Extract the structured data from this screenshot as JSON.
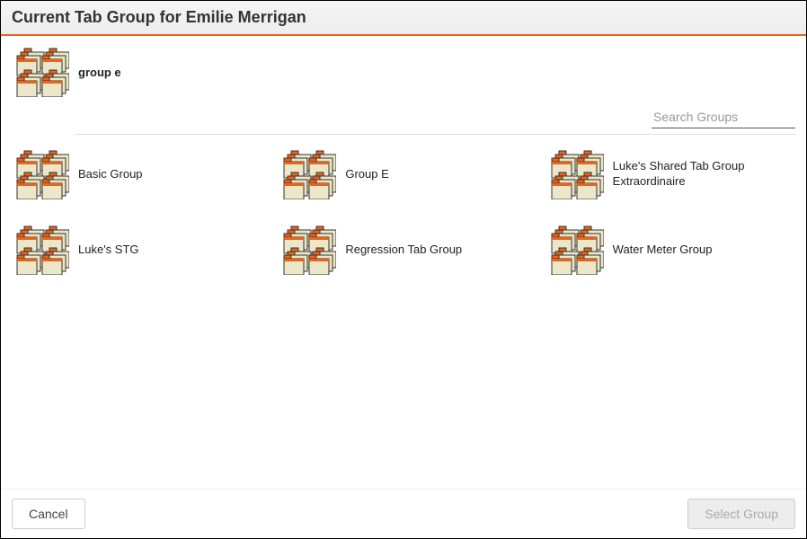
{
  "header": {
    "title": "Current Tab Group for Emilie Merrigan"
  },
  "current_group": {
    "label": "group e"
  },
  "search": {
    "placeholder": "Search Groups"
  },
  "groups": [
    {
      "label": "Basic Group"
    },
    {
      "label": "Group E"
    },
    {
      "label": "Luke's Shared Tab Group Extraordinaire"
    },
    {
      "label": "Luke's STG"
    },
    {
      "label": "Regression Tab Group"
    },
    {
      "label": "Water Meter Group"
    }
  ],
  "footer": {
    "cancel_label": "Cancel",
    "select_label": "Select Group"
  }
}
